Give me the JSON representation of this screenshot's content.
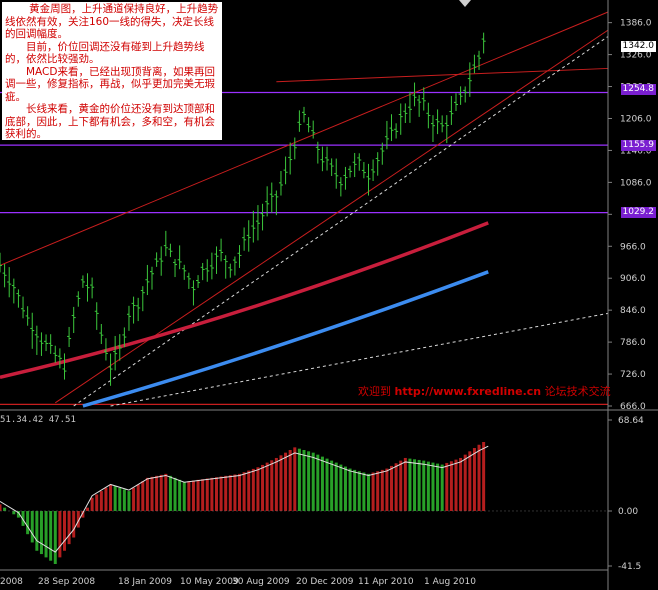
{
  "note": {
    "paragraphs": [
      "黄金周图，上升通道保持良好，上升趋势线依然有效，关注160一线的得失，决定长线的回调幅度。",
      "目前，价位回调还没有碰到上升趋势线的，依然比较强劲。",
      "MACD来看，已经出现顶背离，如果再回调一些，修复指标，再战，似乎更加完美无瑕疵。",
      "长线来看，黄金的价位还没有到达顶部和底部，因此，上下都有机会，多和空，有机会获利的。"
    ]
  },
  "watermark": {
    "prefix": "欢迎到 ",
    "url": "http://www.fxredline.cn",
    "suffix": " 论坛技术交流"
  },
  "oscillator_label": "51.34.42 47.51",
  "current_price_tag": "1342.0",
  "level_tags": [
    "1254.8",
    "1155.9",
    "1029.2"
  ],
  "colors": {
    "background": "#000000",
    "candles": "#3cc83c",
    "ma_red": "#c81e3c",
    "ma_blue": "#3c8cf0",
    "channel": "#c81e1e",
    "level_line": "#9b30ff",
    "hist_red": "#b41e1e",
    "hist_green": "#28a028"
  },
  "chart_data": [
    {
      "type": "ohlc",
      "price_axis": {
        "ylim": [
          666.0,
          1406.0
        ],
        "ticks": [
          "1386.0",
          "1326.0",
          "1266.0",
          "1206.0",
          "1146.0",
          "1086.0",
          "1026.0",
          "966.0",
          "906.0",
          "846.0",
          "786.0",
          "726.0",
          "666.0"
        ]
      },
      "x_labels": [
        "2008",
        "28 Sep 2008",
        "18 Jan 2009",
        "10 May 2009",
        "30 Aug 2009",
        "20 Dec 2009",
        "11 Apr 2010",
        "1 Aug 2010"
      ],
      "close_series": [
        {
          "x": 0,
          "y": 930
        },
        {
          "x": 3,
          "y": 890
        },
        {
          "x": 6,
          "y": 830
        },
        {
          "x": 9,
          "y": 790
        },
        {
          "x": 12,
          "y": 760
        },
        {
          "x": 14,
          "y": 740
        },
        {
          "x": 16,
          "y": 830
        },
        {
          "x": 18,
          "y": 900
        },
        {
          "x": 20,
          "y": 880
        },
        {
          "x": 22,
          "y": 800
        },
        {
          "x": 24,
          "y": 740
        },
        {
          "x": 26,
          "y": 770
        },
        {
          "x": 28,
          "y": 840
        },
        {
          "x": 30,
          "y": 860
        },
        {
          "x": 32,
          "y": 900
        },
        {
          "x": 34,
          "y": 930
        },
        {
          "x": 36,
          "y": 960
        },
        {
          "x": 38,
          "y": 940
        },
        {
          "x": 40,
          "y": 920
        },
        {
          "x": 42,
          "y": 890
        },
        {
          "x": 44,
          "y": 920
        },
        {
          "x": 46,
          "y": 935
        },
        {
          "x": 48,
          "y": 950
        },
        {
          "x": 50,
          "y": 930
        },
        {
          "x": 52,
          "y": 950
        },
        {
          "x": 54,
          "y": 990
        },
        {
          "x": 56,
          "y": 1010
        },
        {
          "x": 58,
          "y": 1040
        },
        {
          "x": 60,
          "y": 1060
        },
        {
          "x": 62,
          "y": 1100
        },
        {
          "x": 64,
          "y": 1160
        },
        {
          "x": 66,
          "y": 1210
        },
        {
          "x": 68,
          "y": 1170
        },
        {
          "x": 70,
          "y": 1130
        },
        {
          "x": 72,
          "y": 1110
        },
        {
          "x": 74,
          "y": 1090
        },
        {
          "x": 76,
          "y": 1110
        },
        {
          "x": 78,
          "y": 1120
        },
        {
          "x": 80,
          "y": 1100
        },
        {
          "x": 82,
          "y": 1130
        },
        {
          "x": 84,
          "y": 1160
        },
        {
          "x": 86,
          "y": 1190
        },
        {
          "x": 88,
          "y": 1220
        },
        {
          "x": 90,
          "y": 1240
        },
        {
          "x": 92,
          "y": 1230
        },
        {
          "x": 94,
          "y": 1200
        },
        {
          "x": 96,
          "y": 1190
        },
        {
          "x": 98,
          "y": 1210
        },
        {
          "x": 100,
          "y": 1240
        },
        {
          "x": 102,
          "y": 1280
        },
        {
          "x": 104,
          "y": 1320
        },
        {
          "x": 106,
          "y": 1390
        }
      ],
      "ma_red": {
        "from": {
          "x": 0,
          "y": 720
        },
        "to": {
          "x": 106,
          "y": 1010
        }
      },
      "ma_blue": {
        "from": {
          "x": 18,
          "y": 666
        },
        "to": {
          "x": 106,
          "y": 918
        }
      },
      "channel_lines": [
        {
          "from": {
            "x": 0,
            "y": 930
          },
          "to": {
            "x": 132,
            "y": 1406
          }
        },
        {
          "from": {
            "x": 12,
            "y": 672
          },
          "to": {
            "x": 132,
            "y": 1372
          }
        },
        {
          "from": {
            "x": 60,
            "y": 1275
          },
          "to": {
            "x": 132,
            "y": 1300
          }
        }
      ],
      "dashed_lines": [
        {
          "from": {
            "x": 16,
            "y": 666
          },
          "to": {
            "x": 132,
            "y": 1360
          }
        },
        {
          "from": {
            "x": 24,
            "y": 666
          },
          "to": {
            "x": 132,
            "y": 840
          }
        }
      ],
      "horizontal_levels": [
        1254.8,
        1155.9,
        1029.2,
        669.0
      ]
    },
    {
      "type": "histogram",
      "ylim": [
        -41.5,
        68.64
      ],
      "ticks": [
        "68.64",
        "0.00",
        "-41.5"
      ],
      "values": [
        {
          "x": 0,
          "y": 5
        },
        {
          "x": 4,
          "y": -5
        },
        {
          "x": 8,
          "y": -30
        },
        {
          "x": 12,
          "y": -40
        },
        {
          "x": 16,
          "y": -20
        },
        {
          "x": 20,
          "y": 10
        },
        {
          "x": 24,
          "y": 20
        },
        {
          "x": 28,
          "y": 15
        },
        {
          "x": 32,
          "y": 25
        },
        {
          "x": 36,
          "y": 28
        },
        {
          "x": 40,
          "y": 22
        },
        {
          "x": 44,
          "y": 24
        },
        {
          "x": 48,
          "y": 26
        },
        {
          "x": 52,
          "y": 28
        },
        {
          "x": 56,
          "y": 33
        },
        {
          "x": 60,
          "y": 40
        },
        {
          "x": 64,
          "y": 48
        },
        {
          "x": 68,
          "y": 44
        },
        {
          "x": 72,
          "y": 38
        },
        {
          "x": 76,
          "y": 32
        },
        {
          "x": 80,
          "y": 28
        },
        {
          "x": 84,
          "y": 32
        },
        {
          "x": 88,
          "y": 40
        },
        {
          "x": 92,
          "y": 38
        },
        {
          "x": 96,
          "y": 35
        },
        {
          "x": 100,
          "y": 40
        },
        {
          "x": 104,
          "y": 50
        },
        {
          "x": 106,
          "y": 54
        }
      ]
    }
  ]
}
